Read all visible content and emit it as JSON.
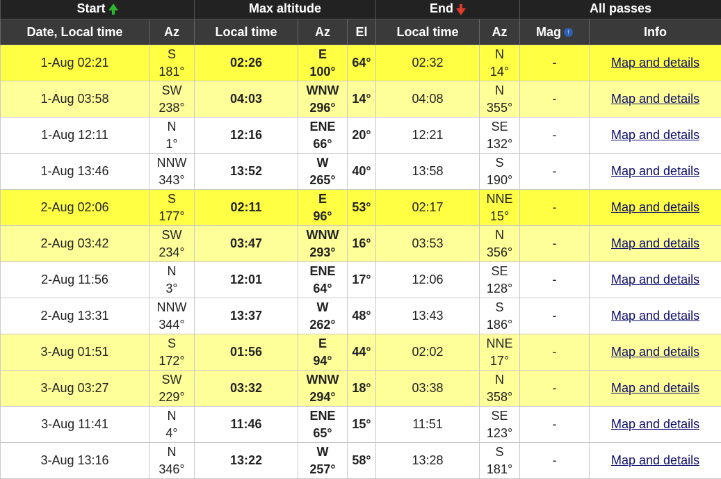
{
  "header": {
    "groups": {
      "start": "Start",
      "max_altitude": "Max altitude",
      "end": "End",
      "all_passes": "All passes"
    },
    "columns": {
      "date_local_time": "Date, Local time",
      "start_az": "Az",
      "max_local_time": "Local time",
      "max_az": "Az",
      "max_el": "El",
      "end_local_time": "Local time",
      "end_az": "Az",
      "mag": "Mag",
      "info": "Info"
    },
    "icons": {
      "start": "arrow-up-icon",
      "end": "arrow-down-icon",
      "mag": "info-icon"
    },
    "mag_icon_glyph": "↑"
  },
  "colors": {
    "bright_row": "#ffff44",
    "pale_row": "#ffff99",
    "white_row": "#ffffff"
  },
  "rows": [
    {
      "shade": "bright",
      "start": "1-Aug 02:21",
      "start_dir": "S",
      "start_deg": "181°",
      "max_time": "02:26",
      "max_dir": "E",
      "max_deg": "100°",
      "el": "64°",
      "end_time": "02:32",
      "end_dir": "N",
      "end_deg": "14°",
      "mag": "-",
      "info": "Map and details"
    },
    {
      "shade": "pale",
      "start": "1-Aug 03:58",
      "start_dir": "SW",
      "start_deg": "238°",
      "max_time": "04:03",
      "max_dir": "WNW",
      "max_deg": "296°",
      "el": "14°",
      "end_time": "04:08",
      "end_dir": "N",
      "end_deg": "355°",
      "mag": "-",
      "info": "Map and details"
    },
    {
      "shade": "white",
      "start": "1-Aug 12:11",
      "start_dir": "N",
      "start_deg": "1°",
      "max_time": "12:16",
      "max_dir": "ENE",
      "max_deg": "66°",
      "el": "20°",
      "end_time": "12:21",
      "end_dir": "SE",
      "end_deg": "132°",
      "mag": "-",
      "info": "Map and details"
    },
    {
      "shade": "white",
      "start": "1-Aug 13:46",
      "start_dir": "NNW",
      "start_deg": "343°",
      "max_time": "13:52",
      "max_dir": "W",
      "max_deg": "265°",
      "el": "40°",
      "end_time": "13:58",
      "end_dir": "S",
      "end_deg": "190°",
      "mag": "-",
      "info": "Map and details"
    },
    {
      "shade": "bright",
      "start": "2-Aug 02:06",
      "start_dir": "S",
      "start_deg": "177°",
      "max_time": "02:11",
      "max_dir": "E",
      "max_deg": "96°",
      "el": "53°",
      "end_time": "02:17",
      "end_dir": "NNE",
      "end_deg": "15°",
      "mag": "-",
      "info": "Map and details"
    },
    {
      "shade": "pale",
      "start": "2-Aug 03:42",
      "start_dir": "SW",
      "start_deg": "234°",
      "max_time": "03:47",
      "max_dir": "WNW",
      "max_deg": "293°",
      "el": "16°",
      "end_time": "03:53",
      "end_dir": "N",
      "end_deg": "356°",
      "mag": "-",
      "info": "Map and details"
    },
    {
      "shade": "white",
      "start": "2-Aug 11:56",
      "start_dir": "N",
      "start_deg": "3°",
      "max_time": "12:01",
      "max_dir": "ENE",
      "max_deg": "64°",
      "el": "17°",
      "end_time": "12:06",
      "end_dir": "SE",
      "end_deg": "128°",
      "mag": "-",
      "info": "Map and details"
    },
    {
      "shade": "white",
      "start": "2-Aug 13:31",
      "start_dir": "NNW",
      "start_deg": "344°",
      "max_time": "13:37",
      "max_dir": "W",
      "max_deg": "262°",
      "el": "48°",
      "end_time": "13:43",
      "end_dir": "S",
      "end_deg": "186°",
      "mag": "-",
      "info": "Map and details"
    },
    {
      "shade": "pale",
      "start": "3-Aug 01:51",
      "start_dir": "S",
      "start_deg": "172°",
      "max_time": "01:56",
      "max_dir": "E",
      "max_deg": "94°",
      "el": "44°",
      "end_time": "02:02",
      "end_dir": "NNE",
      "end_deg": "17°",
      "mag": "-",
      "info": "Map and details"
    },
    {
      "shade": "pale",
      "start": "3-Aug 03:27",
      "start_dir": "SW",
      "start_deg": "229°",
      "max_time": "03:32",
      "max_dir": "WNW",
      "max_deg": "294°",
      "el": "18°",
      "end_time": "03:38",
      "end_dir": "N",
      "end_deg": "358°",
      "mag": "-",
      "info": "Map and details"
    },
    {
      "shade": "white",
      "start": "3-Aug 11:41",
      "start_dir": "N",
      "start_deg": "4°",
      "max_time": "11:46",
      "max_dir": "ENE",
      "max_deg": "65°",
      "el": "15°",
      "end_time": "11:51",
      "end_dir": "SE",
      "end_deg": "123°",
      "mag": "-",
      "info": "Map and details"
    },
    {
      "shade": "white",
      "start": "3-Aug 13:16",
      "start_dir": "N",
      "start_deg": "346°",
      "max_time": "13:22",
      "max_dir": "W",
      "max_deg": "257°",
      "el": "58°",
      "end_time": "13:28",
      "end_dir": "S",
      "end_deg": "181°",
      "mag": "-",
      "info": "Map and details"
    }
  ]
}
